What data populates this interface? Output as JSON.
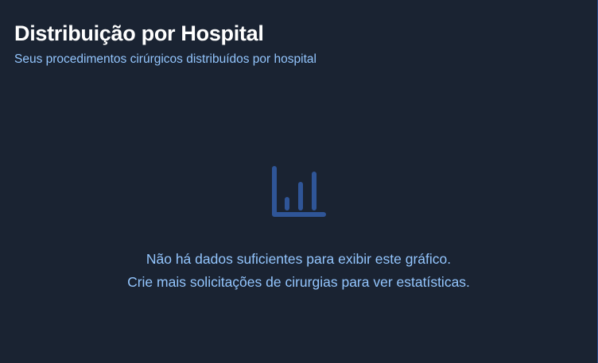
{
  "card": {
    "title": "Distribuição por Hospital",
    "subtitle": "Seus procedimentos cirúrgicos distribuídos por hospital"
  },
  "empty_state": {
    "icon": "bar-chart-icon",
    "message_line1": "Não há dados suficientes para exibir este gráfico.",
    "message_line2": "Crie mais solicitações de cirurgias para ver estatísticas."
  },
  "colors": {
    "background": "#1a2332",
    "title": "#ffffff",
    "accent_text": "#93c5fd",
    "icon": "#2f5597"
  }
}
